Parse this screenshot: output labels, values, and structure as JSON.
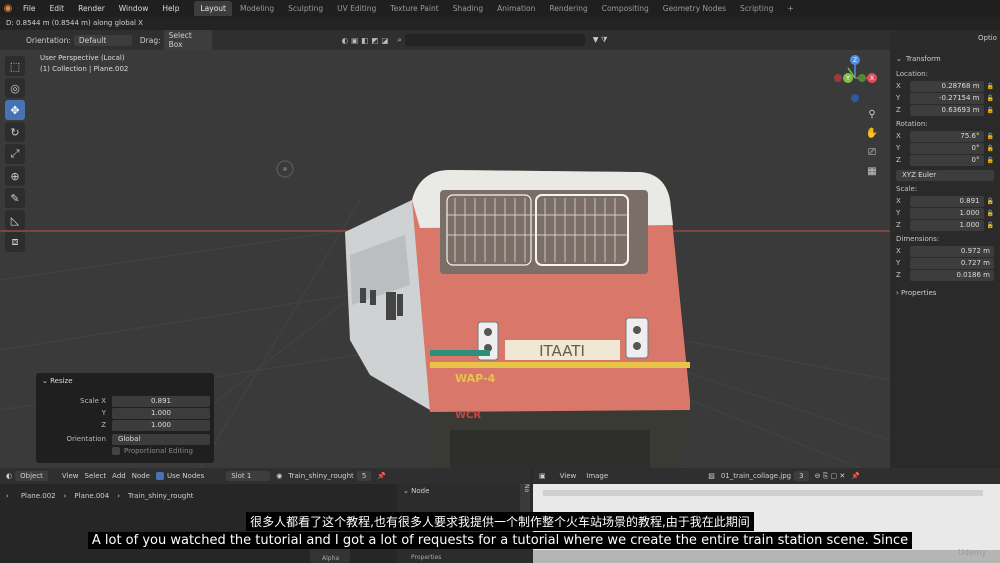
{
  "menu": [
    "File",
    "Edit",
    "Render",
    "Window",
    "Help"
  ],
  "workspaces": [
    "Layout",
    "Modeling",
    "Sculpting",
    "UV Editing",
    "Texture Paint",
    "Shading",
    "Animation",
    "Rendering",
    "Compositing",
    "Geometry Nodes",
    "Scripting"
  ],
  "add_tab": "+",
  "status_text": "D: 0.8544 m (0.8544 m) along global X",
  "header": {
    "orientation_label": "Orientation:",
    "orientation_value": "Default",
    "drag_label": "Drag:",
    "drag_value": "Select Box",
    "options_label": "Optio"
  },
  "viewport": {
    "perspective": "User Perspective (Local)",
    "collection": "(1) Collection | Plane.002",
    "train_sign": "ITAATI",
    "train_code_left": "WAP-4",
    "train_code_right": "WCR"
  },
  "gizmo": {
    "x": "X",
    "y": "Y",
    "z": "Z"
  },
  "transform": {
    "title": "Transform",
    "location_label": "Location:",
    "location": [
      {
        "axis": "X",
        "value": "0.28768 m"
      },
      {
        "axis": "Y",
        "value": "-0.27154 m"
      },
      {
        "axis": "Z",
        "value": "0.63693 m"
      }
    ],
    "rotation_label": "Rotation:",
    "rotation": [
      {
        "axis": "X",
        "value": "75.6°"
      },
      {
        "axis": "Y",
        "value": "0°"
      },
      {
        "axis": "Z",
        "value": "0°"
      }
    ],
    "rotation_mode": "XYZ Euler",
    "scale_label": "Scale:",
    "scale": [
      {
        "axis": "X",
        "value": "0.891"
      },
      {
        "axis": "Y",
        "value": "1.000"
      },
      {
        "axis": "Z",
        "value": "1.000"
      }
    ],
    "dimensions_label": "Dimensions:",
    "dimensions": [
      {
        "axis": "X",
        "value": "0.972 m"
      },
      {
        "axis": "Y",
        "value": "0.727 m"
      },
      {
        "axis": "Z",
        "value": "0.0186 m"
      }
    ],
    "properties_label": "Properties"
  },
  "resize": {
    "title": "Resize",
    "rows": [
      {
        "label": "Scale X",
        "value": "0.891"
      },
      {
        "label": "Y",
        "value": "1.000"
      },
      {
        "label": "Z",
        "value": "1.000"
      }
    ],
    "orientation_label": "Orientation",
    "orientation_value": "Global",
    "proportional_label": "Proportional Editing"
  },
  "node_editor": {
    "mode": "Object",
    "menus": [
      "View",
      "Select",
      "Add",
      "Node"
    ],
    "use_nodes": "Use Nodes",
    "slot": "Slot 1",
    "material": "Train_shiny_rought",
    "users": "5",
    "breadcrumb": [
      "Plane.002",
      "Plane.004",
      "Train_shiny_rought"
    ],
    "sidebar_title": "Node",
    "sidebar_tab": "No",
    "alpha_label": "Alpha",
    "properties_label": "Properties"
  },
  "image_editor": {
    "menus": [
      "View",
      "Image"
    ],
    "image_name": "01_train_collage.jpg",
    "users": "3"
  },
  "subtitles": {
    "zh": "很多人都看了这个教程,也有很多人要求我提供一个制作整个火车站场景的教程,由于我在此期间",
    "en": "A lot of you watched the tutorial and I got a lot of requests for a tutorial where we create the entire train station scene. Since"
  },
  "watermark": "Udemy",
  "colors": {
    "accent": "#4772b3",
    "x_axis": "#e0505a",
    "y_axis": "#7fc04a",
    "z_axis": "#4d8fe0",
    "train_front": "#d9776a",
    "stripe_yellow": "#e8c34a"
  }
}
